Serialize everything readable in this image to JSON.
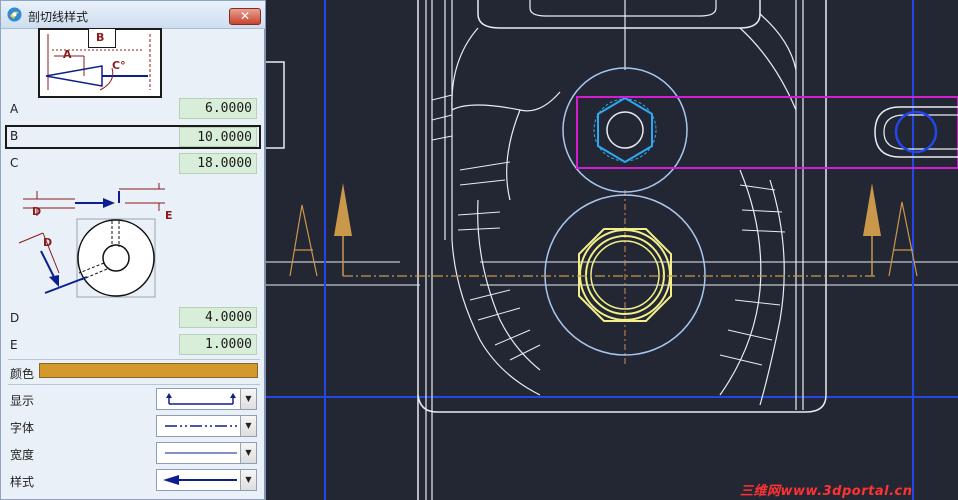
{
  "panel": {
    "title": "剖切线样式",
    "close_glyph": "✕",
    "diagram_top": {
      "label_b": "B",
      "label_a": "A",
      "label_c": "C°"
    },
    "diagram_bottom": {
      "label_d1": "D",
      "label_d2": "D",
      "label_e": "E"
    },
    "fields": {
      "a": {
        "label": "A",
        "value": "6.0000"
      },
      "b": {
        "label": "B",
        "value": "10.0000"
      },
      "c": {
        "label": "C",
        "value": "18.0000"
      },
      "d": {
        "label": "D",
        "value": "4.0000"
      },
      "e": {
        "label": "E",
        "value": "1.0000"
      }
    },
    "color": {
      "label": "颜色",
      "value": "#d39a2b"
    },
    "display": {
      "label": "显示"
    },
    "font": {
      "label": "字体"
    },
    "width": {
      "label": "宽度"
    },
    "style": {
      "label": "样式"
    }
  },
  "canvas": {
    "section_label_left": "A",
    "section_label_right": "A",
    "colors": {
      "background": "#222733",
      "outline": "#e9ecf2",
      "light_blue": "#a9c6ee",
      "blue": "#2346e8",
      "magenta": "#d21ed2",
      "cyan": "#2fa8f2",
      "yellow": "#f2ee8a",
      "section_line": "#c9984a"
    }
  },
  "watermark": "三维网www.3dportal.cn"
}
